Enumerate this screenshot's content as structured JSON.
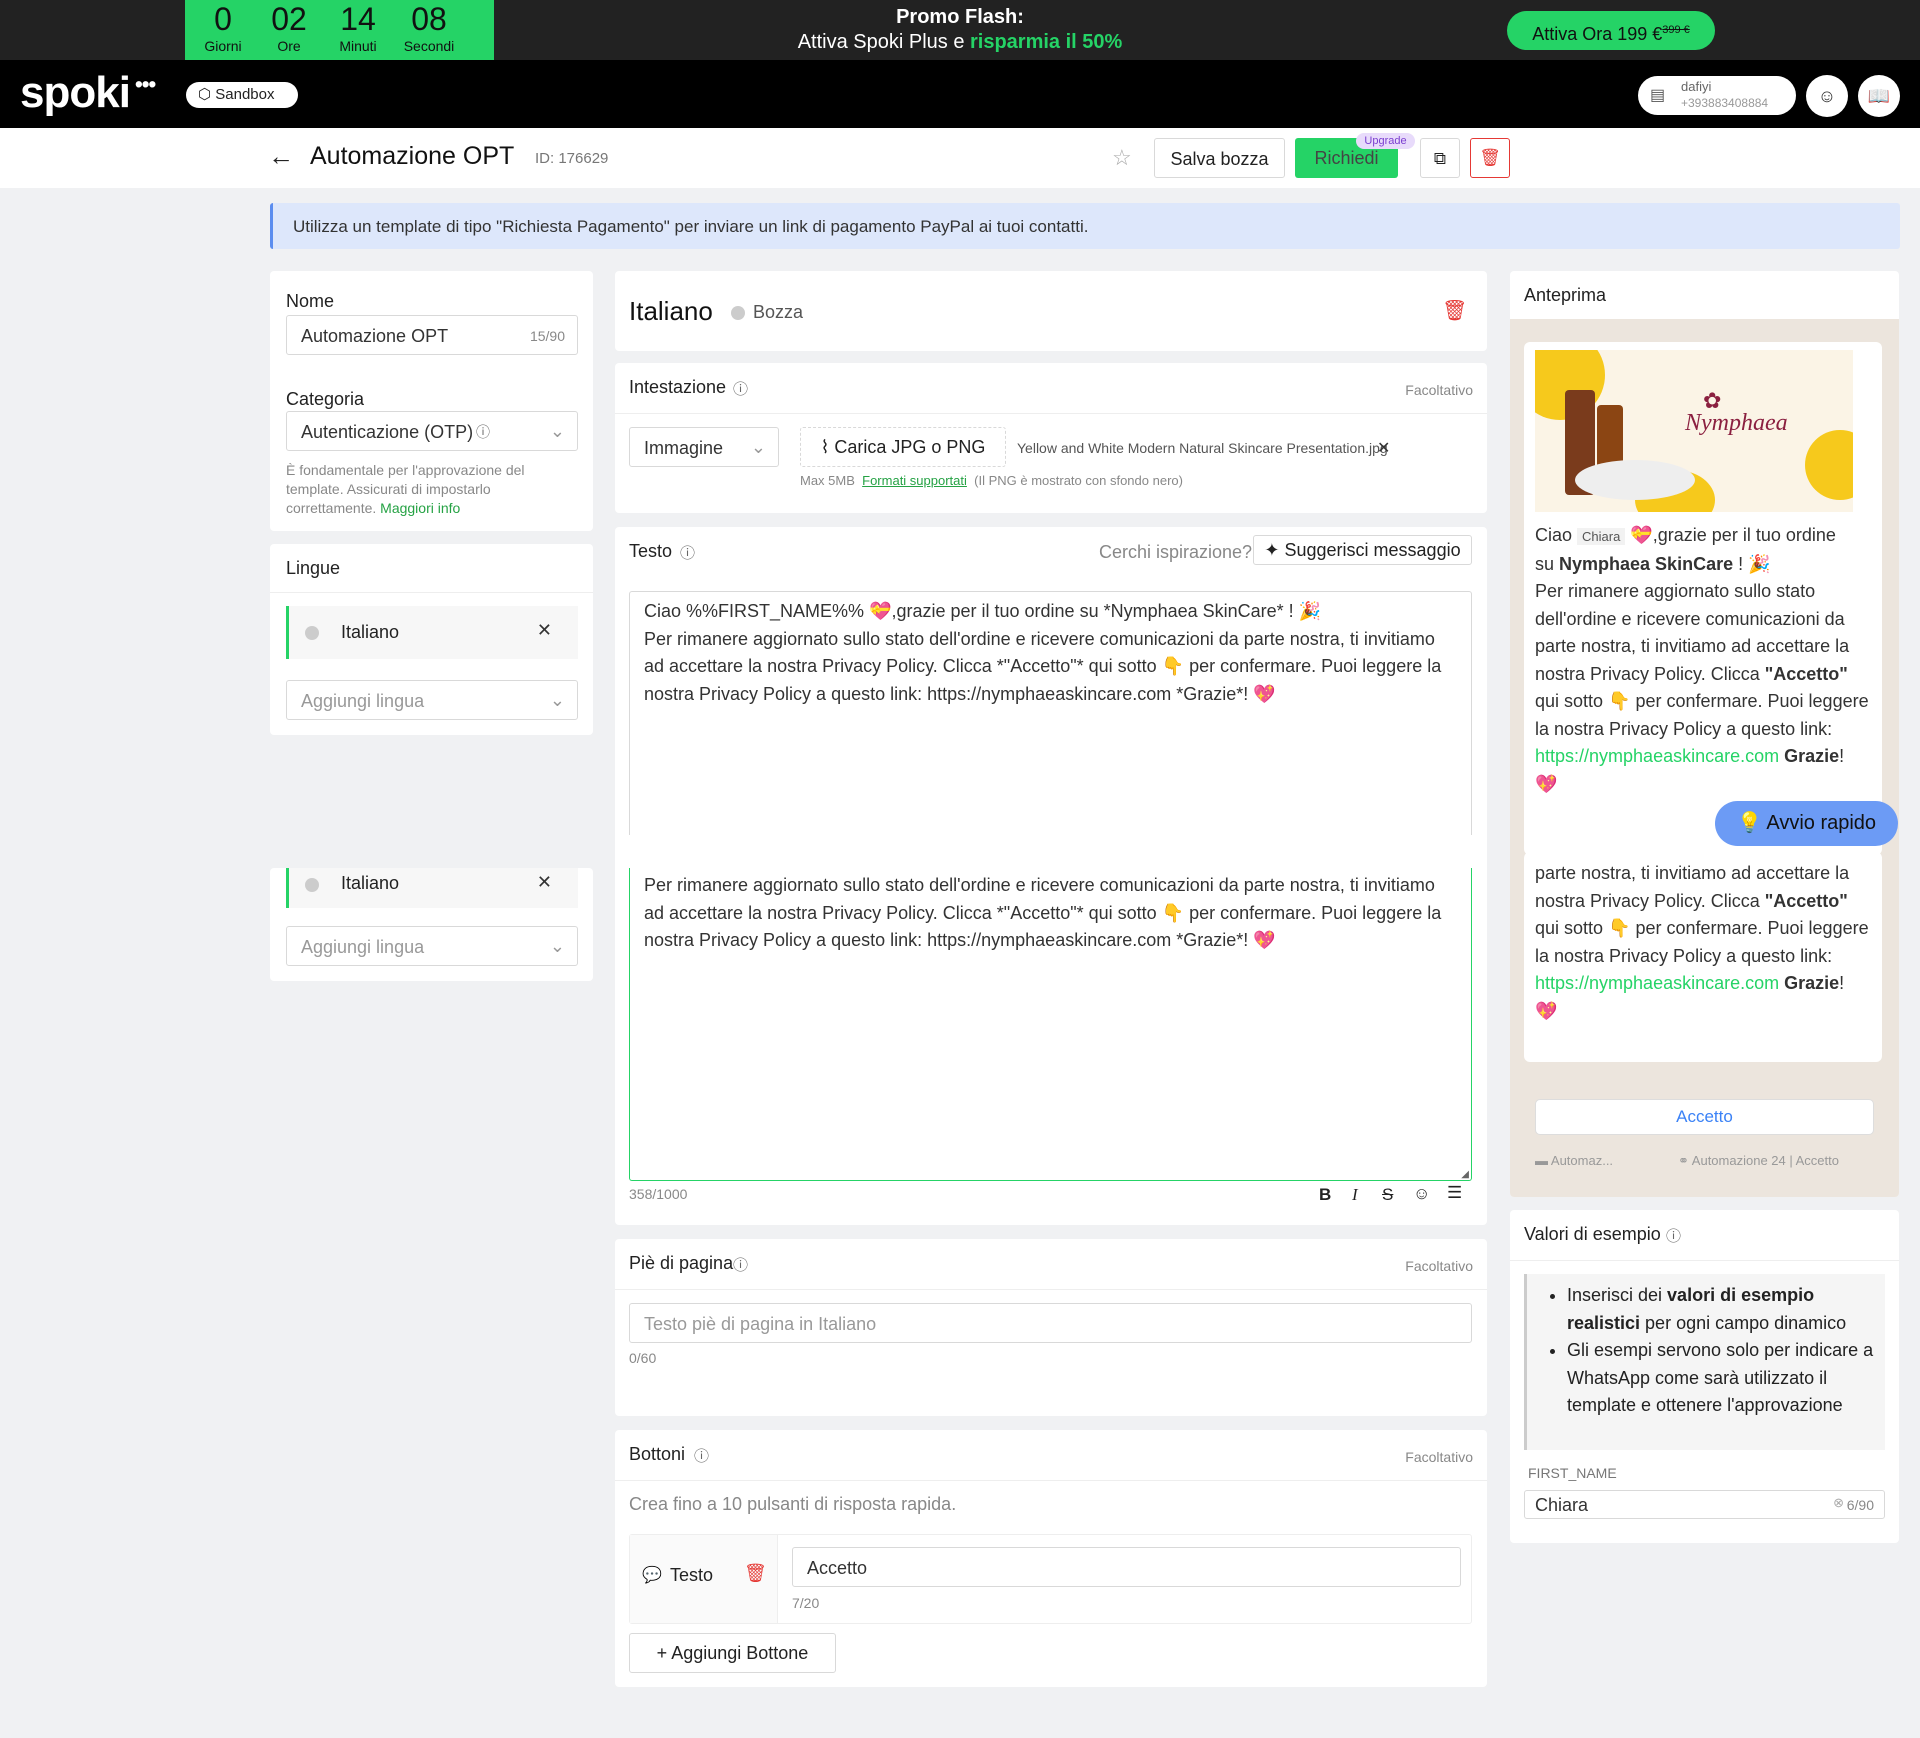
{
  "promo": {
    "days": "0",
    "hours": "02",
    "minutes": "14",
    "seconds": "08",
    "days_label": "Giorni",
    "hours_label": "Ore",
    "minutes_label": "Minuti",
    "seconds_label": "Secondi",
    "title": "Promo Flash:",
    "subtitle_a": "Attiva Spoki Plus e ",
    "subtitle_b": "risparmia il 50%",
    "cta": "Attiva Ora 199 €",
    "cta_old": "399 €"
  },
  "topbar": {
    "logo": "spoki",
    "sandbox": "Sandbox",
    "user_name": "dafiyi",
    "user_phone": "+393883408884"
  },
  "header": {
    "title": "Automazione OPT",
    "id": "ID: 176629",
    "save_draft": "Salva bozza",
    "request": "Richiedi",
    "upgrade": "Upgrade"
  },
  "banner": {
    "text": "Utilizza un template di tipo \"Richiesta Pagamento\" per inviare un link di pagamento PayPal ai tuoi contatti."
  },
  "left": {
    "name_label": "Nome",
    "name_value": "Automazione OPT",
    "name_count": "15/90",
    "category_label": "Categoria",
    "category_value": "Autenticazione (OTP)",
    "category_help": "È fondamentale per l'approvazione del template. Assicurati di impostarlo correttamente.",
    "category_link": "Maggiori info",
    "languages_label": "Lingue",
    "language_item": "Italiano",
    "add_language": "Aggiungi lingua"
  },
  "editor": {
    "lang_title": "Italiano",
    "status": "Bozza",
    "header_label": "Intestazione",
    "optional": "Facoltativo",
    "media_type": "Immagine",
    "upload": "Carica JPG o PNG",
    "file_name": "Yellow and White Modern Natural Skincare Presentation.jpg",
    "max_size": "Max 5MB",
    "formats": "Formati supportati",
    "png_note": "(Il PNG è mostrato con sfondo nero)",
    "text_label": "Testo",
    "inspiration": "Cerchi ispirazione?",
    "suggest": "Suggerisci messaggio",
    "msg_line1": "Ciao %%FIRST_NAME%% 💝,grazie per il tuo ordine su *Nymphaea SkinCare* ! 🎉",
    "msg_body": "Per rimanere aggiornato sullo stato dell'ordine e ricevere comunicazioni da parte nostra, ti invitiamo ad accettare la nostra Privacy Policy. Clicca *\"Accetto\"* qui sotto 👇 per confermare. Puoi leggere la nostra Privacy Policy a questo link: https://nymphaeaskincare.com *Grazie*! 💖",
    "char_count": "358/1000",
    "footer_label": "Piè di pagina",
    "footer_placeholder": "Testo piè di pagina in Italiano",
    "footer_count": "0/60",
    "buttons_label": "Bottoni",
    "buttons_help": "Crea fino a 10 pulsanti di risposta rapida.",
    "button_type": "Testo",
    "button_value": "Accetto",
    "button_count": "7/20",
    "add_button": "Aggiungi Bottone"
  },
  "preview": {
    "title": "Anteprima",
    "greeting": "Ciao",
    "name_chip": "Chiara",
    "after_name": "💝,grazie per il tuo ordine",
    "line2a": "su ",
    "line2b": "Nymphaea SkinCare",
    "line2c": " ! 🎉",
    "body1": "Per rimanere aggiornato sullo stato dell'ordine e ricevere comunicazioni da parte nostra, ti invitiamo ad accettare la nostra Privacy Policy. Clicca ",
    "accetto_bold": "\"Accetto\"",
    "body2": " qui sotto 👇 per confermare. Puoi leggere la nostra Privacy Policy a questo link: ",
    "link": "https://nymphaeaskincare.com",
    "grazie": "Grazie",
    "end": "!",
    "heart": "💖",
    "button": "Accetto",
    "footer_left": "Automaz...",
    "footer_right": "Automazione 24 | Accetto",
    "quick_start": "Avvio rapido",
    "brand": "Nymphaea"
  },
  "examples": {
    "title": "Valori di esempio",
    "bullet1a": "Inserisci dei ",
    "bullet1b": "valori di esempio realistici",
    "bullet1c": " per ogni campo dinamico",
    "bullet2": "Gli esempi servono solo per indicare a WhatsApp come sarà utilizzato il template e ottenere l'approvazione",
    "field_label": "FIRST_NAME",
    "field_value": "Chiara",
    "field_count": "6/90"
  },
  "colors": {
    "accent": "#25d366",
    "dark": "#222222",
    "danger": "#e53935",
    "banner": "#dde7fb",
    "quick": "#5b8def"
  }
}
